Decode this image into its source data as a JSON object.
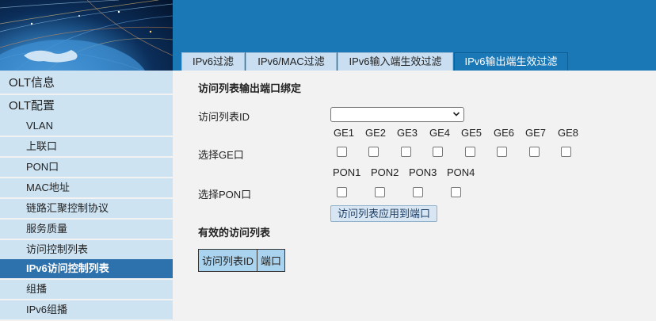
{
  "tabs": [
    "IPv6过滤",
    "IPv6/MAC过滤",
    "IPv6输入端生效过滤",
    "IPv6输出端生效过滤"
  ],
  "active_tab_index": 3,
  "sidebar": {
    "items": [
      {
        "label": "OLT信息",
        "level": "top"
      },
      {
        "label": "OLT配置",
        "level": "top"
      },
      {
        "label": "VLAN",
        "level": "sub"
      },
      {
        "label": "上联口",
        "level": "sub"
      },
      {
        "label": "PON口",
        "level": "sub"
      },
      {
        "label": "MAC地址",
        "level": "sub"
      },
      {
        "label": "链路汇聚控制协议",
        "level": "sub"
      },
      {
        "label": "服务质量",
        "level": "sub"
      },
      {
        "label": "访问控制列表",
        "level": "sub"
      },
      {
        "label": "IPv6访问控制列表",
        "level": "sub",
        "active": true
      },
      {
        "label": "组播",
        "level": "sub"
      },
      {
        "label": "IPv6组播",
        "level": "sub"
      }
    ]
  },
  "main": {
    "section_title": "访问列表输出端口绑定",
    "acl_id_label": "访问列表ID",
    "acl_id_value": "",
    "ge_label": "选择GE口",
    "ge_ports": [
      "GE1",
      "GE2",
      "GE3",
      "GE4",
      "GE5",
      "GE6",
      "GE7",
      "GE8"
    ],
    "pon_label": "选择PON口",
    "pon_ports": [
      "PON1",
      "PON2",
      "PON3",
      "PON4"
    ],
    "apply_button": "访问列表应用到端口",
    "effective_title": "有效的访问列表",
    "table_headers": [
      "访问列表ID",
      "端口"
    ]
  },
  "colors": {
    "banner_blue": "#1a78b6",
    "sidebar_bg": "#cde3f2",
    "active_item": "#2e72ad",
    "table_header": "#a9d3ee"
  }
}
